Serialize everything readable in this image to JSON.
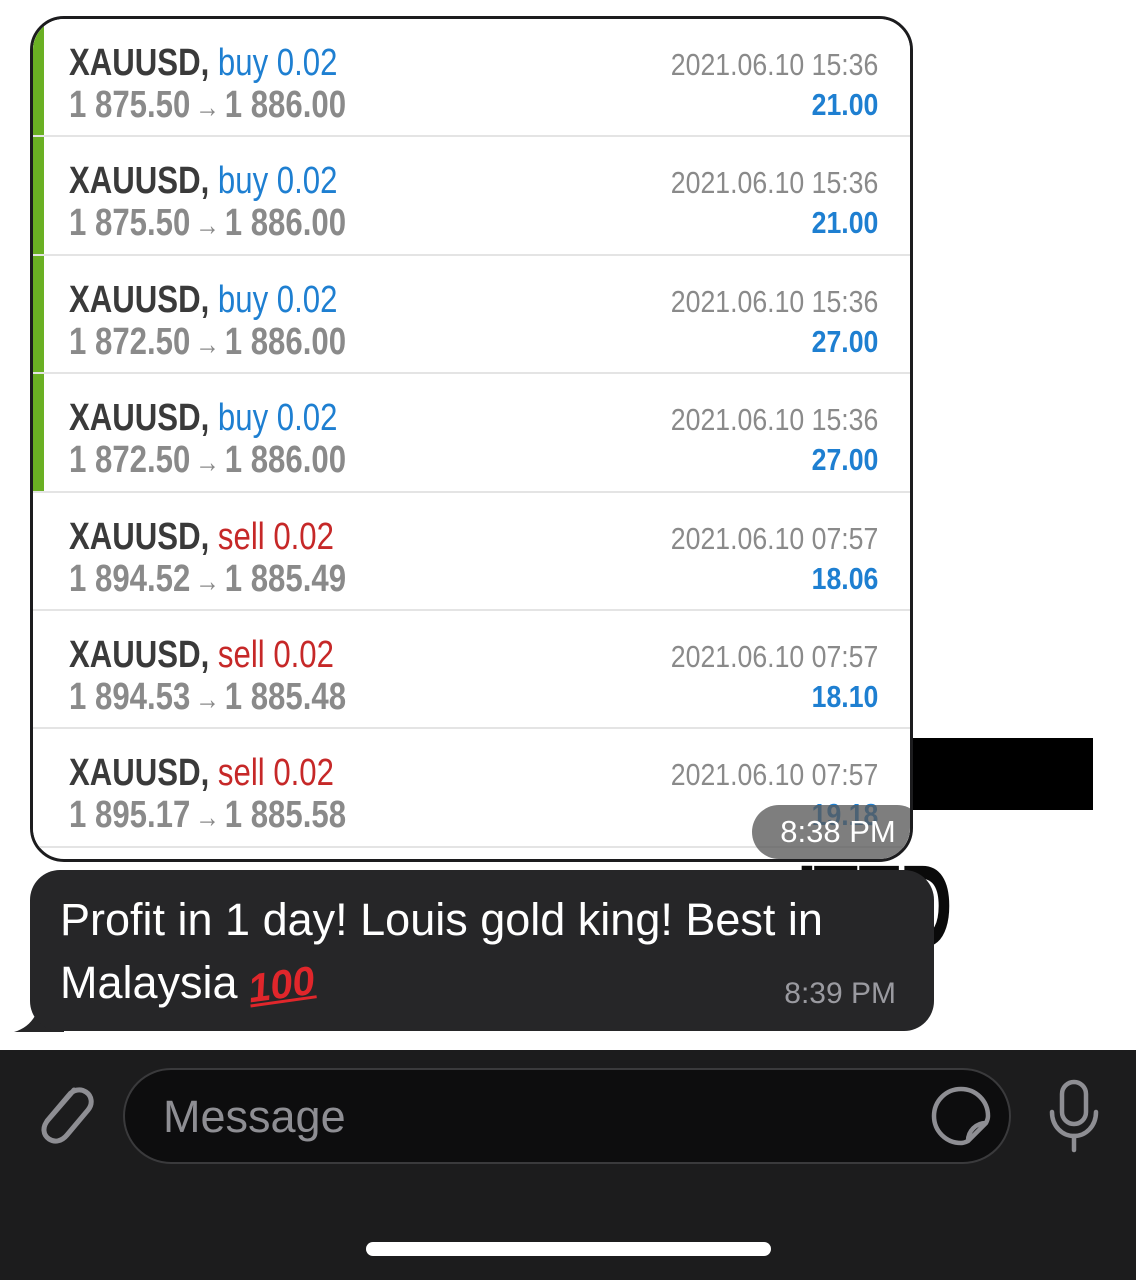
{
  "image_message": {
    "trades": [
      {
        "symbol": "XAUUSD,",
        "type": "buy 0.02",
        "side": "buy",
        "open": "1 875.50",
        "close": "1 886.00",
        "date": "2021.06.10 15:36",
        "profit": "21.00"
      },
      {
        "symbol": "XAUUSD,",
        "type": "buy 0.02",
        "side": "buy",
        "open": "1 875.50",
        "close": "1 886.00",
        "date": "2021.06.10 15:36",
        "profit": "21.00"
      },
      {
        "symbol": "XAUUSD,",
        "type": "buy 0.02",
        "side": "buy",
        "open": "1 872.50",
        "close": "1 886.00",
        "date": "2021.06.10 15:36",
        "profit": "27.00"
      },
      {
        "symbol": "XAUUSD,",
        "type": "buy 0.02",
        "side": "buy",
        "open": "1 872.50",
        "close": "1 886.00",
        "date": "2021.06.10 15:36",
        "profit": "27.00"
      },
      {
        "symbol": "XAUUSD,",
        "type": "sell 0.02",
        "side": "sell",
        "open": "1 894.52",
        "close": "1 885.49",
        "date": "2021.06.10 07:57",
        "profit": "18.06"
      },
      {
        "symbol": "XAUUSD,",
        "type": "sell 0.02",
        "side": "sell",
        "open": "1 894.53",
        "close": "1 885.48",
        "date": "2021.06.10 07:57",
        "profit": "18.10"
      },
      {
        "symbol": "XAUUSD,",
        "type": "sell 0.02",
        "side": "sell",
        "open": "1 895.17",
        "close": "1 885.58",
        "date": "2021.06.10 07:57",
        "profit": "19.18"
      }
    ],
    "arrow": "→",
    "timestamp": "8:38 PM"
  },
  "text_message": {
    "text": "Profit in 1 day! Louis gold king! Best in Malaysia",
    "emoji": "100",
    "timestamp": "8:39 PM"
  },
  "background": {
    "visible_text": "ITED"
  },
  "composer": {
    "placeholder": "Message",
    "icons": {
      "attach": "paperclip-icon",
      "sticker": "sticker-icon",
      "mic": "microphone-icon"
    }
  },
  "colors": {
    "buy": "#1e7fd1",
    "sell": "#c62828",
    "profit": "#1e7fd1",
    "buy_accent": "#6ab023",
    "bubble": "#262628"
  }
}
